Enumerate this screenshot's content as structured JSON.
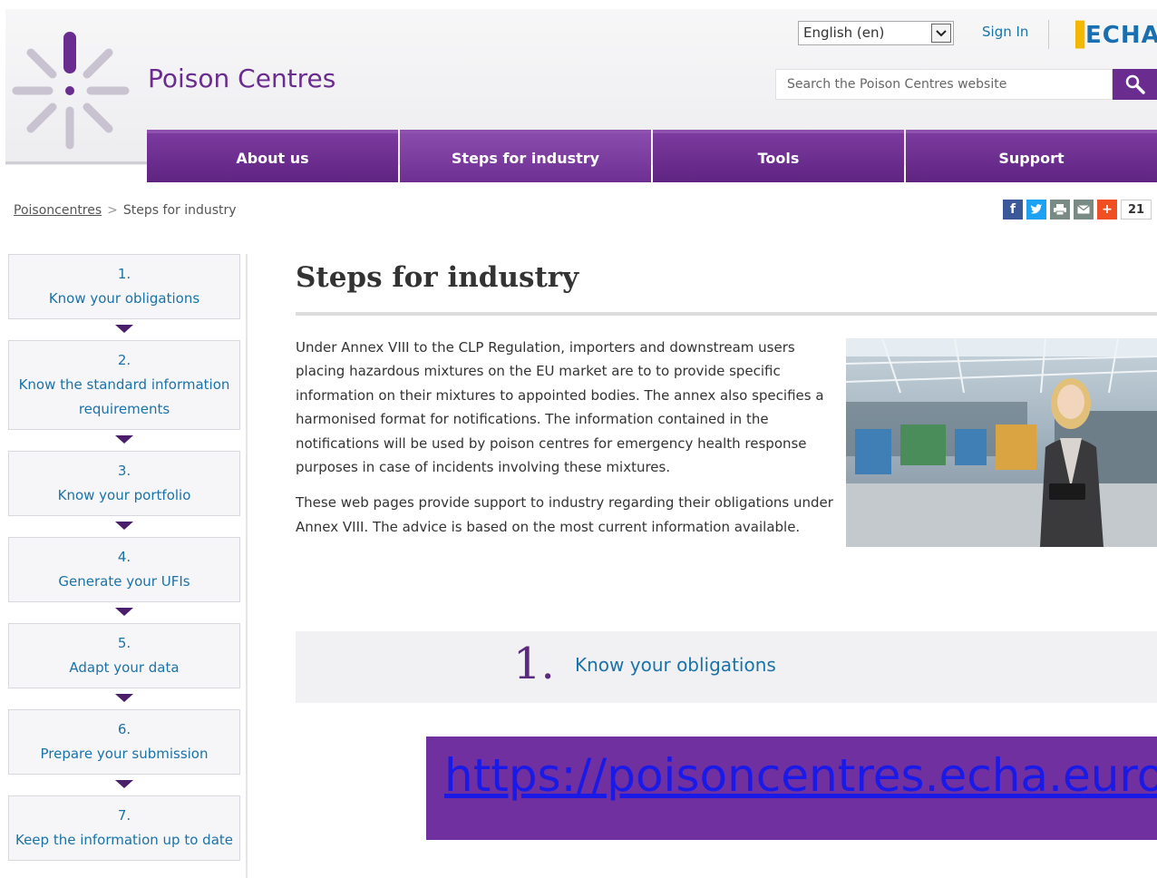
{
  "header": {
    "site_title": "Poison Centres",
    "language": "English (en)",
    "sign_in": "Sign In",
    "agency_logo": "ECHA",
    "search_placeholder": "Search the Poison Centres website",
    "brand_color": "#6b2c8f"
  },
  "nav": {
    "items": [
      {
        "label": "About us"
      },
      {
        "label": "Steps for industry"
      },
      {
        "label": "Tools"
      },
      {
        "label": "Support"
      }
    ],
    "active": "Steps for industry"
  },
  "breadcrumb": {
    "home": "Poisoncentres",
    "separator": ">",
    "current": "Steps for industry"
  },
  "share": {
    "icons": [
      "facebook-icon",
      "twitter-icon",
      "print-icon",
      "email-icon",
      "plus-icon"
    ],
    "count": "21"
  },
  "sidebar": {
    "steps": [
      {
        "num": "1.",
        "label": "Know your obligations"
      },
      {
        "num": "2.",
        "label": "Know the standard information requirements"
      },
      {
        "num": "3.",
        "label": "Know your portfolio"
      },
      {
        "num": "4.",
        "label": "Generate your UFIs"
      },
      {
        "num": "5.",
        "label": "Adapt your data"
      },
      {
        "num": "6.",
        "label": "Prepare your submission"
      },
      {
        "num": "7.",
        "label": "Keep the information up to date"
      }
    ]
  },
  "main": {
    "title": "Steps for industry",
    "paragraph1": "Under Annex VIII to the CLP Regulation, importers and downstream users placing hazardous mixtures on the EU market are to to provide specific information on their mixtures to appointed bodies. The annex also specifies a harmonised format for notifications. The information contained in the notifications will be used by poison centres for emergency health response purposes in case of incidents involving these mixtures.",
    "paragraph2": "These web pages provide support to industry regarding their obligations under Annex VIII. The advice is based on the most current information available.",
    "step_box": {
      "num": "1.",
      "label": "Know your obligations"
    }
  },
  "url_banner": {
    "text": "https://poisoncentres.echa.europa.eu"
  }
}
